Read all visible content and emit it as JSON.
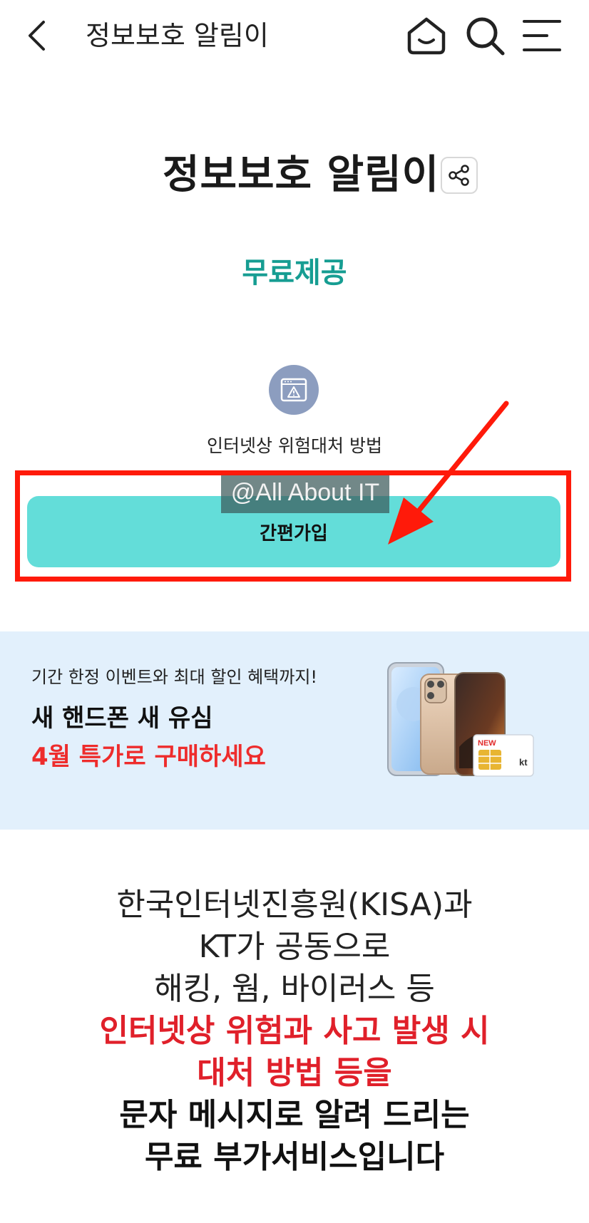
{
  "header": {
    "title": "정보보호 알림이",
    "back_icon": "chevron-left-icon",
    "home_icon": "home-icon",
    "search_icon": "search-icon",
    "menu_icon": "menu-icon"
  },
  "main": {
    "title": "정보보호 알림이",
    "share_icon": "share-icon",
    "price": "무료제공",
    "feature": {
      "icon": "browser-warning-icon",
      "label": "인터넷상 위험대처 방법"
    },
    "join_button": "간편가입",
    "watermark": "@All About IT"
  },
  "banner": {
    "subtitle": "기간 한정 이벤트와 최대 할인 혜택까지!",
    "line1": "새 핸드폰 새 유심",
    "line2": "4월 특가로 구매하세요",
    "sim_badge": "NEW",
    "sim_brand": "kt"
  },
  "description": {
    "line1": "한국인터넷진흥원(KISA)과",
    "line2": "KT가 공동으로",
    "line3": "해킹, 웜, 바이러스 등",
    "line4": "인터넷상 위험과 사고 발생 시",
    "line5": "대처 방법 등을",
    "line6": "문자 메시지로 알려 드리는",
    "line7": "무료 부가서비스입니다"
  },
  "colors": {
    "accent_teal": "#169d92",
    "button_bg": "#63ddd9",
    "highlight_red": "#ff1a0a",
    "text_red": "#e0202a",
    "banner_bg": "#e2f0fc"
  }
}
